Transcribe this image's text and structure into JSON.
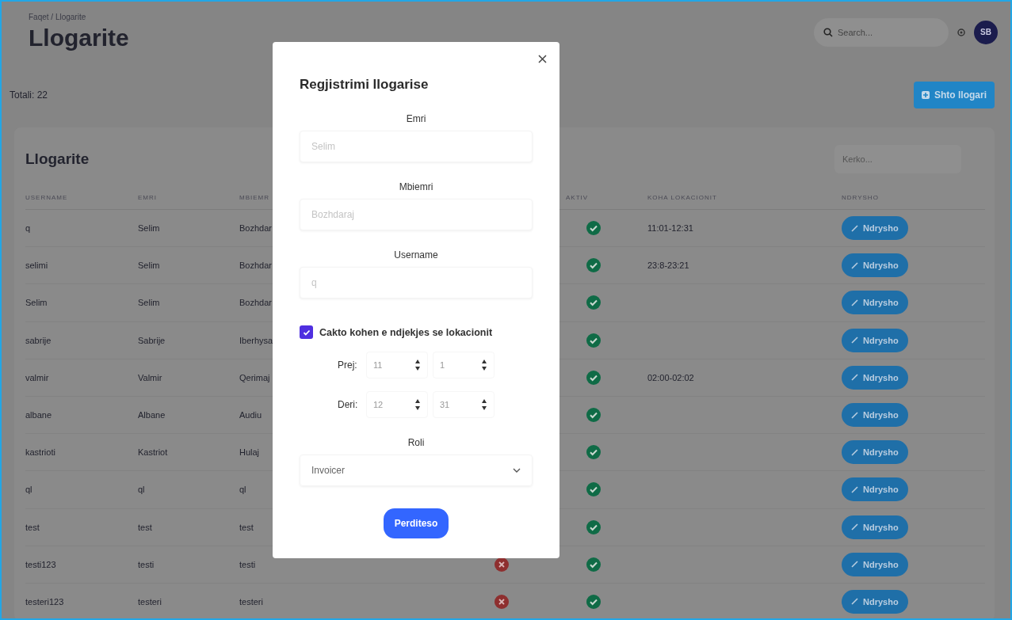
{
  "breadcrumb": "Faqet / Llogarite",
  "title": "Llogarite",
  "search": {
    "placeholder": "Search..."
  },
  "avatar": "SB",
  "total": "Totali: 22",
  "add_button": "Shto llogari",
  "card": {
    "title": "Llogarite",
    "search": {
      "placeholder": "Kerko..."
    },
    "columns": [
      "USERNAME",
      "EMRI",
      "MBIEMR",
      "AKTIV",
      "KOHA LOKACIONIT",
      "NDRYSHO"
    ],
    "rows": [
      {
        "username": "q",
        "emri": "Selim",
        "mbiemri": "Bozhdar",
        "aktiv": true,
        "koha": "11:01-12:31",
        "action": "Ndrysho"
      },
      {
        "username": "selimi",
        "emri": "Selim",
        "mbiemri": "Bozhdar",
        "aktiv": true,
        "koha": "23:8-23:21",
        "action": "Ndrysho"
      },
      {
        "username": "Selim",
        "emri": "Selim",
        "mbiemri": "Bozhdar",
        "aktiv": true,
        "action": "Ndrysho"
      },
      {
        "username": "sabrije",
        "emri": "Sabrije",
        "mbiemri": "Iberhysa",
        "aktiv": true,
        "action": "Ndrysho"
      },
      {
        "username": "valmir",
        "emri": "Valmir",
        "mbiemri": "Qerimaj",
        "aktiv": true,
        "koha": "02:00-02:02",
        "action": "Ndrysho"
      },
      {
        "username": "albane",
        "emri": "Albane",
        "mbiemri": "Audiu",
        "aktiv": true,
        "action": "Ndrysho"
      },
      {
        "username": "kastrioti",
        "emri": "Kastriot",
        "mbiemri": "Hulaj",
        "aktiv": true,
        "action": "Ndrysho"
      },
      {
        "username": "ql",
        "emri": "ql",
        "mbiemri": "ql",
        "aktiv": true,
        "action": "Ndrysho"
      },
      {
        "username": "test",
        "emri": "test",
        "mbiemri": "test",
        "aktiv": true,
        "action": "Ndrysho"
      },
      {
        "username": "testi123",
        "emri": "testi",
        "mbiemri": "testi",
        "column_4": false,
        "aktiv": true,
        "action": "Ndrysho"
      },
      {
        "username": "testeri123",
        "emri": "testeri",
        "mbiemri": "testeri",
        "column_4": false,
        "aktiv": true,
        "action": "Ndrysho"
      }
    ]
  },
  "modal": {
    "title": "Regjistrimi llogarise",
    "fields": [
      {
        "label": "Emri",
        "placeholder": "Selim"
      },
      {
        "label": "Mbiemri",
        "placeholder": "Bozhdaraj"
      },
      {
        "label": "Username",
        "placeholder": "q"
      }
    ],
    "tracking": {
      "label": "Cakto kohen e ndjekjes se lokacionit",
      "checked": true
    },
    "time_rows": [
      {
        "label": "Prej:",
        "hour": "11",
        "minute": "1"
      },
      {
        "label": "Deri:",
        "hour": "12",
        "minute": "31"
      }
    ],
    "role": {
      "label": "Roli",
      "value": "Invoicer"
    },
    "submit": "Perditeso"
  }
}
